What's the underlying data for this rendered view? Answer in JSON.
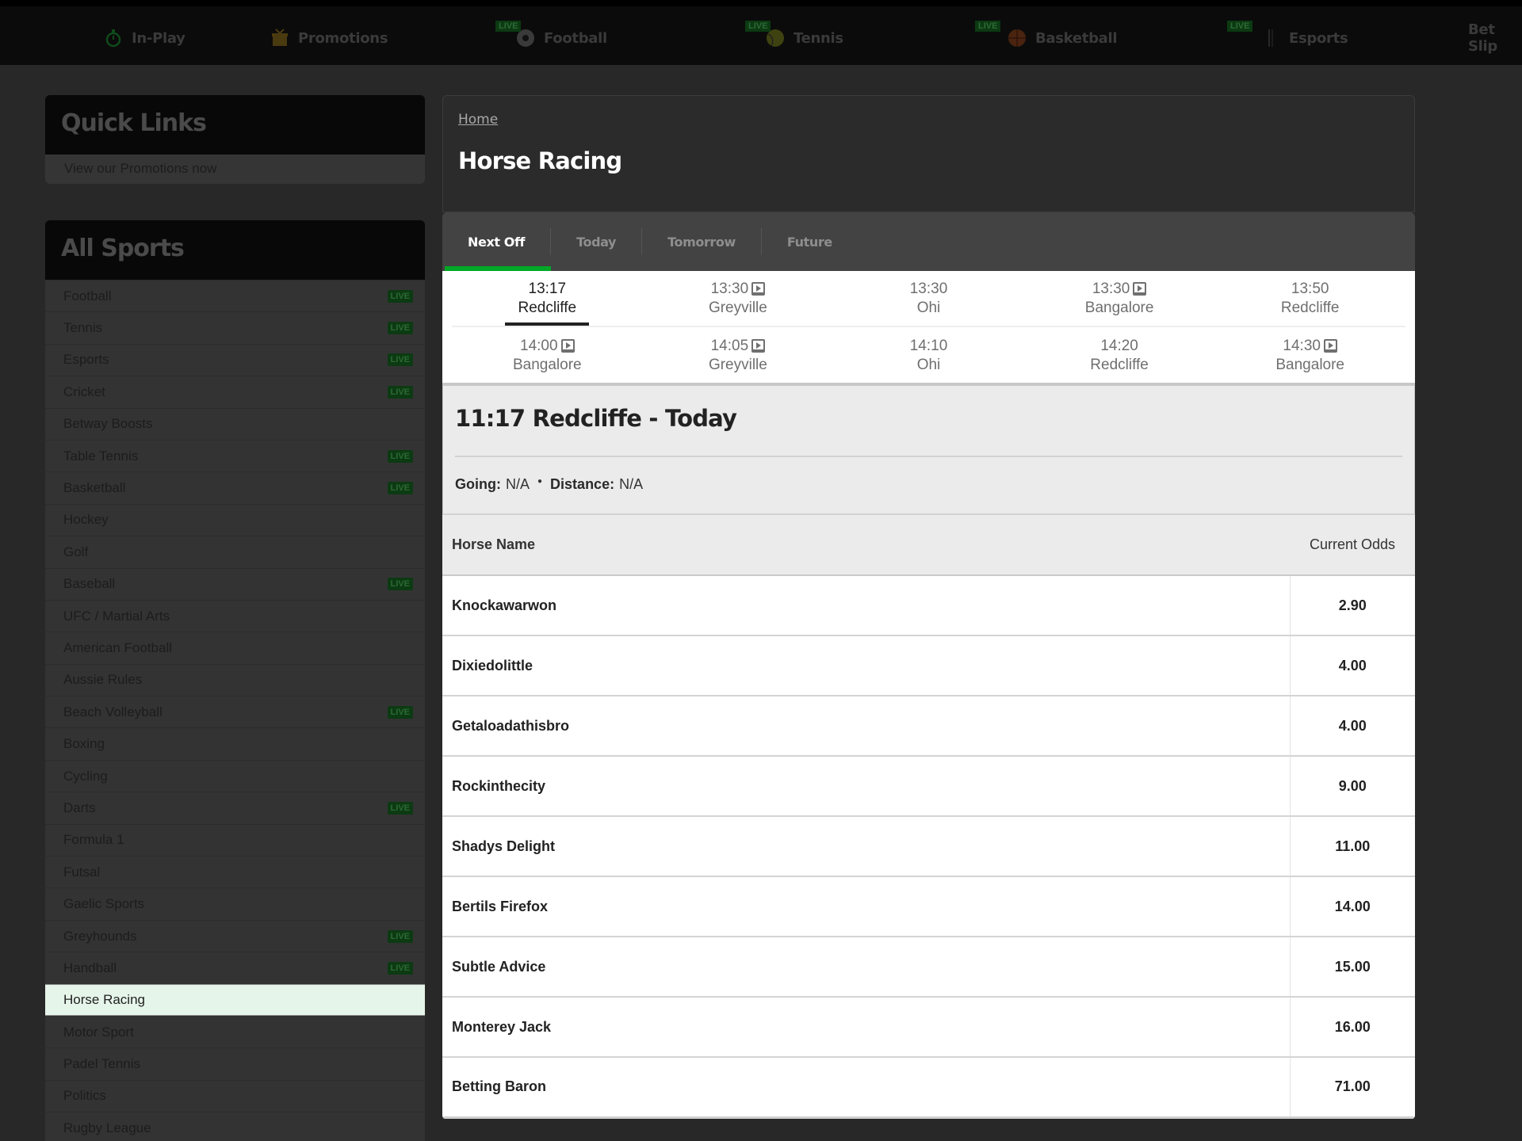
{
  "topnav": {
    "items": [
      {
        "label": "In-Play",
        "icon": "stopwatch-icon",
        "live": false
      },
      {
        "label": "Promotions",
        "icon": "gift-icon",
        "live": false
      },
      {
        "label": "Football",
        "icon": "football-icon",
        "live": true
      },
      {
        "label": "Tennis",
        "icon": "tennis-ball-icon",
        "live": true
      },
      {
        "label": "Basketball",
        "icon": "basketball-icon",
        "live": true
      },
      {
        "label": "Esports",
        "icon": "esports-icon",
        "live": true
      },
      {
        "label": "Bet Slip",
        "icon": "",
        "live": false
      }
    ],
    "live_label": "LIVE"
  },
  "sidebar": {
    "quick_links": {
      "title": "Quick Links",
      "links": [
        "View our Promotions now"
      ]
    },
    "all_sports": {
      "title": "All Sports",
      "live_label": "LIVE",
      "items": [
        {
          "label": "Football",
          "live": true
        },
        {
          "label": "Tennis",
          "live": true
        },
        {
          "label": "Esports",
          "live": true
        },
        {
          "label": "Cricket",
          "live": true
        },
        {
          "label": "Betway Boosts",
          "live": false
        },
        {
          "label": "Table Tennis",
          "live": true
        },
        {
          "label": "Basketball",
          "live": true
        },
        {
          "label": "Hockey",
          "live": false
        },
        {
          "label": "Golf",
          "live": false
        },
        {
          "label": "Baseball",
          "live": true
        },
        {
          "label": "UFC / Martial Arts",
          "live": false
        },
        {
          "label": "American Football",
          "live": false
        },
        {
          "label": "Aussie Rules",
          "live": false
        },
        {
          "label": "Beach Volleyball",
          "live": true
        },
        {
          "label": "Boxing",
          "live": false
        },
        {
          "label": "Cycling",
          "live": false
        },
        {
          "label": "Darts",
          "live": true
        },
        {
          "label": "Formula 1",
          "live": false
        },
        {
          "label": "Futsal",
          "live": false
        },
        {
          "label": "Gaelic Sports",
          "live": false
        },
        {
          "label": "Greyhounds",
          "live": true
        },
        {
          "label": "Handball",
          "live": true
        },
        {
          "label": "Horse Racing",
          "live": false,
          "active": true
        },
        {
          "label": "Motor Sport",
          "live": false
        },
        {
          "label": "Padel Tennis",
          "live": false
        },
        {
          "label": "Politics",
          "live": false
        },
        {
          "label": "Rugby League",
          "live": false
        }
      ]
    }
  },
  "main": {
    "breadcrumb": "Home",
    "title": "Horse Racing",
    "tabs": [
      {
        "label": "Next Off",
        "active": true
      },
      {
        "label": "Today",
        "active": false
      },
      {
        "label": "Tomorrow",
        "active": false
      },
      {
        "label": "Future",
        "active": false
      }
    ],
    "races": [
      [
        {
          "time": "13:17",
          "venue": "Redcliffe",
          "tv": false,
          "active": true
        },
        {
          "time": "13:30",
          "venue": "Greyville",
          "tv": true
        },
        {
          "time": "13:30",
          "venue": "Ohi",
          "tv": false
        },
        {
          "time": "13:30",
          "venue": "Bangalore",
          "tv": true
        },
        {
          "time": "13:50",
          "venue": "Redcliffe",
          "tv": false
        }
      ],
      [
        {
          "time": "14:00",
          "venue": "Bangalore",
          "tv": true
        },
        {
          "time": "14:05",
          "venue": "Greyville",
          "tv": true
        },
        {
          "time": "14:10",
          "venue": "Ohi",
          "tv": false
        },
        {
          "time": "14:20",
          "venue": "Redcliffe",
          "tv": false
        },
        {
          "time": "14:30",
          "venue": "Bangalore",
          "tv": true
        }
      ]
    ],
    "race": {
      "title": "11:17 Redcliffe - Today",
      "going_label": "Going:",
      "going_value": "N/A",
      "distance_label": "Distance:",
      "distance_value": "N/A"
    },
    "table": {
      "col_name": "Horse Name",
      "col_odds": "Current Odds",
      "rows": [
        {
          "name": "Knockawarwon",
          "odds": "2.90"
        },
        {
          "name": "Dixiedolittle",
          "odds": "4.00"
        },
        {
          "name": "Getaloadathisbro",
          "odds": "4.00"
        },
        {
          "name": "Rockinthecity",
          "odds": "9.00"
        },
        {
          "name": "Shadys Delight",
          "odds": "11.00"
        },
        {
          "name": "Bertils Firefox",
          "odds": "14.00"
        },
        {
          "name": "Subtle Advice",
          "odds": "15.00"
        },
        {
          "name": "Monterey Jack",
          "odds": "16.00"
        },
        {
          "name": "Betting Baron",
          "odds": "71.00"
        }
      ]
    }
  },
  "colors": {
    "accent_green": "#00a826",
    "live_badge": "#0c3a12",
    "active_sport_bg": "#e6f5ea"
  }
}
